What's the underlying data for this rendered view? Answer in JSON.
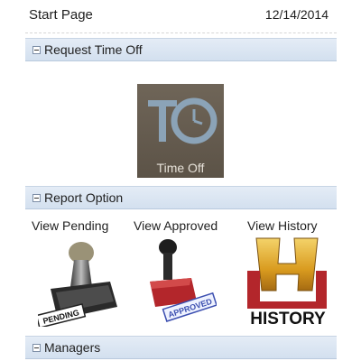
{
  "header": {
    "title": "Start Page",
    "date": "12/14/2014"
  },
  "sections": {
    "request": {
      "label": "Request Time Off"
    },
    "report": {
      "label": "Report Option"
    },
    "managers": {
      "label": "Managers"
    }
  },
  "time_off_tile": {
    "caption": "Time Off"
  },
  "report_options": {
    "pending": {
      "label": "View Pending",
      "stamp_text": "PENDING"
    },
    "approved": {
      "label": "View Approved",
      "stamp_text": "APPROVED"
    },
    "history": {
      "label": "View History",
      "logo_text": "HISTORY"
    }
  },
  "colors": {
    "section_bar": "#d9e4f1",
    "tile_bg": "#645b4f",
    "history_gold": "#e2b43a",
    "stamp_red": "#b3262b"
  }
}
